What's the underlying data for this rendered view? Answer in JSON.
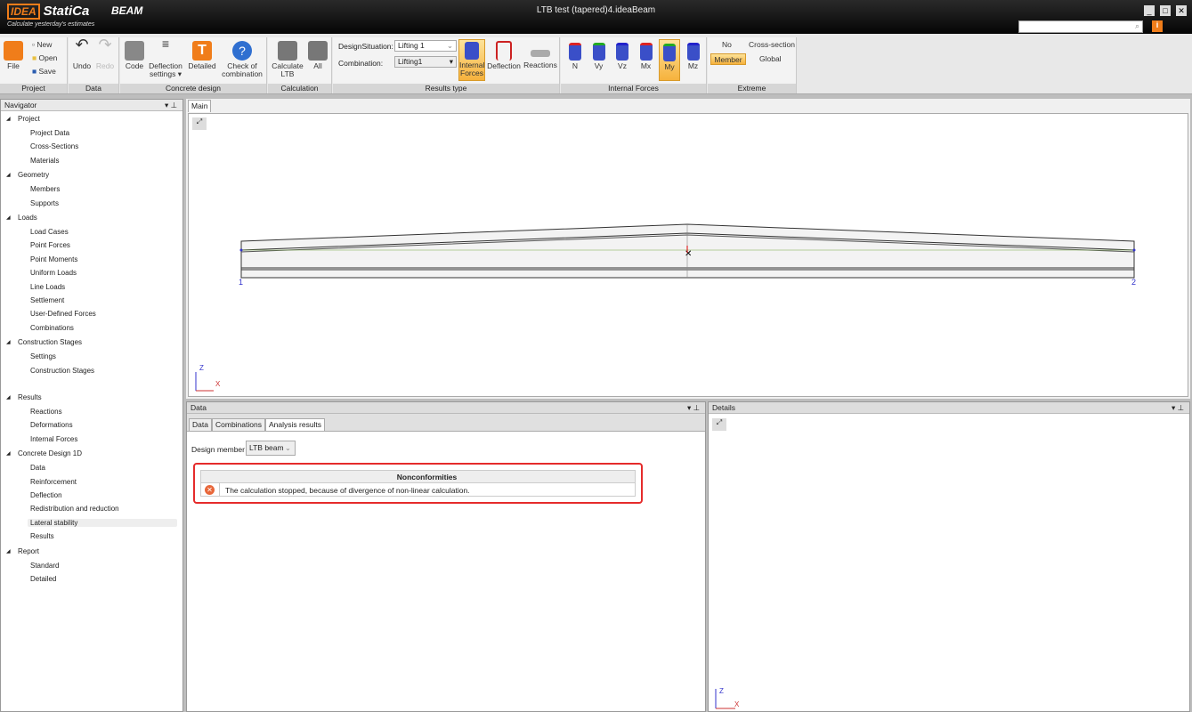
{
  "app": {
    "brand": "IDEA",
    "product": "StatiCa",
    "module": "BEAM",
    "slogan": "Calculate yesterday's estimates",
    "window_title": "LTB test (tapered)4.ideaBeam"
  },
  "ribbon": {
    "project": {
      "label": "Project",
      "file": "File",
      "new": "New",
      "open": "Open",
      "save": "Save"
    },
    "data": {
      "label": "Data",
      "undo": "Undo",
      "redo": "Redo"
    },
    "concrete": {
      "label": "Concrete design",
      "code": "Code",
      "deflection": "Deflection settings",
      "detailed": "Detailed",
      "check": "Check of combination"
    },
    "calculation": {
      "label": "Calculation",
      "ltb": "Calculate LTB",
      "all": "All"
    },
    "results": {
      "label": "Results type",
      "ds_label": "DesignSituation:",
      "ds_value": "Lifting 1",
      "comb_label": "Combination:",
      "comb_value": "Lifting1",
      "internal": "Internal Forces",
      "deflection": "Deflection",
      "reactions": "Reactions"
    },
    "forces": {
      "label": "Internal Forces",
      "items": [
        "N",
        "Vy",
        "Vz",
        "Mx",
        "My",
        "Mz"
      ],
      "selected": "My"
    },
    "extreme": {
      "label": "Extreme",
      "no": "No",
      "cross": "Cross-section",
      "member": "Member",
      "global": "Global"
    }
  },
  "navigator": {
    "title": "Navigator",
    "tree": [
      {
        "label": "Project",
        "children": [
          "Project Data",
          "Cross-Sections",
          "Materials"
        ]
      },
      {
        "label": "Geometry",
        "children": [
          "Members",
          "Supports"
        ]
      },
      {
        "label": "Loads",
        "children": [
          "Load Cases",
          "Point Forces",
          "Point Moments",
          "Uniform Loads",
          "Line Loads",
          "Settlement",
          "User-Defined Forces",
          "Combinations"
        ]
      },
      {
        "label": "Construction Stages",
        "children": [
          "Settings",
          "Construction Stages"
        ]
      },
      {
        "label": "Results",
        "children": [
          "Reactions",
          "Deformations",
          "Internal Forces"
        ]
      },
      {
        "label": "Concrete Design 1D",
        "children": [
          "Data",
          "Reinforcement",
          "Deflection",
          "Redistribution and reduction",
          "Lateral stability",
          "Results"
        ]
      },
      {
        "label": "Report",
        "children": [
          "Standard",
          "Detailed"
        ]
      }
    ],
    "selected": "Lateral stability"
  },
  "main": {
    "tab": "Main",
    "node1": "1",
    "node2": "2",
    "axis_z": "Z",
    "axis_x": "X"
  },
  "data_panel": {
    "title": "Data",
    "tabs": [
      "Data",
      "Combinations",
      "Analysis results"
    ],
    "active_tab": "Analysis results",
    "design_member_label": "Design member",
    "design_member_value": "LTB beam",
    "table_header": "Nonconformities",
    "message": "The calculation stopped, because of divergence of non-linear calculation."
  },
  "details": {
    "title": "Details"
  }
}
